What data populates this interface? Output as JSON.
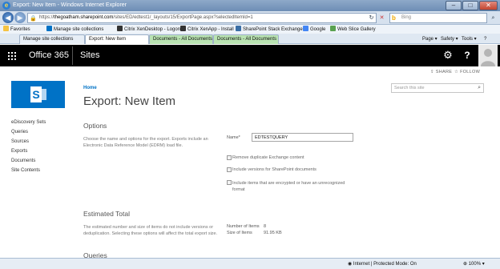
{
  "window": {
    "title": "Export: New Item - Windows Internet Explorer"
  },
  "addressbar": {
    "url_prefix": "https://",
    "url_host": "thegoatham.sharepoint.com",
    "url_path": "/sites/ED/edtest1/_layouts/15/ExportPage.aspx?selectedItemId=1",
    "search_placeholder": "Bing"
  },
  "favorites": {
    "label": "Favorites",
    "items": [
      "Manage site collections",
      "Citrix XenDesktop - Logon",
      "Citrix XenApp - Install",
      "SharePoint Stack Exchange",
      "Google",
      "Web Slice Gallery"
    ]
  },
  "tabs": [
    "Manage site collections",
    "Export: New Item",
    "Documents - All Documents",
    "Documents - All Documents"
  ],
  "commandbar": {
    "page": "Page",
    "safety": "Safety",
    "tools": "Tools"
  },
  "suitebar": {
    "app": "Office 365",
    "section": "Sites"
  },
  "actions": {
    "share": "SHARE",
    "follow": "FOLLOW"
  },
  "search": {
    "placeholder": "Search this site"
  },
  "breadcrumb": {
    "home": "Home"
  },
  "page": {
    "title": "Export: New Item"
  },
  "quicklaunch": [
    "eDiscovery Sets",
    "Queries",
    "Sources",
    "Exports",
    "Documents",
    "Site Contents"
  ],
  "options": {
    "heading": "Options",
    "description": "Choose the name and options for the export. Exports include an Electronic Data Reference Model (EDRM) load file.",
    "name_label": "Name*",
    "name_value": "EDTESTQUERY",
    "checkbox_1": "Remove duplicate Exchange content",
    "checkbox_2": "Include versions for SharePoint documents",
    "checkbox_3": "Include items that are encrypted or have an unrecognized format"
  },
  "estimated": {
    "heading": "Estimated Total",
    "description": "The estimated number and size of items do not include versions or deduplication. Selecting these options will affect the total export size.",
    "items_label": "Number of Items",
    "items_value": "8",
    "size_label": "Size of Items",
    "size_value": "91.95 KB"
  },
  "queries": {
    "heading": "Queries"
  },
  "statusbar": {
    "zone": "Internet | Protected Mode: On",
    "zoom": "100%"
  },
  "colors": {
    "suite_bar": "#000000",
    "sharepoint_blue": "#0072c6",
    "ie_title": "#7a97bd"
  },
  "icons": [
    "ie-logo-icon",
    "back-icon",
    "forward-icon",
    "lock-icon",
    "refresh-icon",
    "stop-icon",
    "bing-icon",
    "search-icon",
    "star-icon",
    "waffle-icon",
    "gear-icon",
    "help-icon",
    "share-icon",
    "follow-icon",
    "globe-icon",
    "zoom-icon"
  ]
}
